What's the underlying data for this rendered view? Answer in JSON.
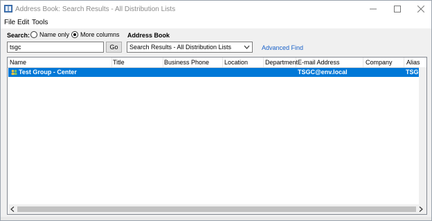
{
  "window": {
    "title": "Address Book: Search Results - All Distribution Lists"
  },
  "menu": [
    "File",
    "Edit",
    "Tools"
  ],
  "search": {
    "label": "Search:",
    "options": [
      "Name only",
      "More columns"
    ],
    "selected_option": "More columns",
    "value": "tsgc",
    "go_label": "Go"
  },
  "address_book": {
    "label": "Address Book",
    "selected": "Search Results - All Distribution Lists",
    "advanced_find": "Advanced Find"
  },
  "results": {
    "columns": [
      "Name",
      "Title",
      "Business Phone",
      "Location",
      "Department",
      "E-mail Address",
      "Company",
      "Alias"
    ],
    "rows": [
      {
        "name": "Test Group - Center",
        "title": "",
        "business_phone": "",
        "location": "",
        "department": "",
        "email": "TSGC@env.local",
        "company": "",
        "alias": "TSGC",
        "selected": true
      }
    ]
  },
  "colors": {
    "selection": "#0078d7",
    "link": "#1a62c9"
  },
  "icons": [
    "address-book-icon",
    "minimize-icon",
    "maximize-icon",
    "close-icon",
    "chevron-down-icon",
    "distribution-group-icon",
    "arrow-left-icon",
    "arrow-right-icon"
  ]
}
